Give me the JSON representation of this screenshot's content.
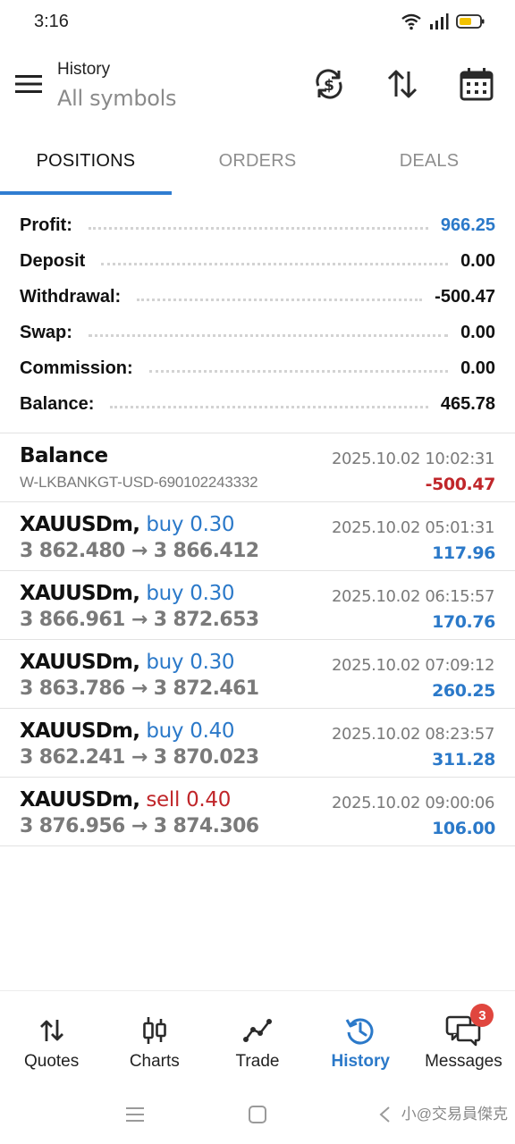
{
  "status_bar": {
    "time": "3:16"
  },
  "header": {
    "title": "History",
    "subtitle": "All symbols"
  },
  "tabs": [
    {
      "label": "POSITIONS",
      "active": true
    },
    {
      "label": "ORDERS",
      "active": false
    },
    {
      "label": "DEALS",
      "active": false
    }
  ],
  "summary": {
    "profit": {
      "label": "Profit:",
      "value": "966.25"
    },
    "deposit": {
      "label": "Deposit",
      "value": "0.00"
    },
    "withdrawal": {
      "label": "Withdrawal:",
      "value": "-500.47"
    },
    "swap": {
      "label": "Swap:",
      "value": "0.00"
    },
    "commission": {
      "label": "Commission:",
      "value": "0.00"
    },
    "balance": {
      "label": "Balance:",
      "value": "465.78"
    }
  },
  "entries": [
    {
      "title": "Balance",
      "subtitle": "W-LKBANKGT-USD-690102243332",
      "time": "2025.10.02 10:02:31",
      "amount": "-500.47"
    },
    {
      "symbol": "XAUUSDm,",
      "direction": "buy 0.30",
      "prices": "3 862.480 → 3 866.412",
      "time": "2025.10.02 05:01:31",
      "profit": "117.96"
    },
    {
      "symbol": "XAUUSDm,",
      "direction": "buy 0.30",
      "prices": "3 866.961 → 3 872.653",
      "time": "2025.10.02 06:15:57",
      "profit": "170.76"
    },
    {
      "symbol": "XAUUSDm,",
      "direction": "buy 0.30",
      "prices": "3 863.786 → 3 872.461",
      "time": "2025.10.02 07:09:12",
      "profit": "260.25"
    },
    {
      "symbol": "XAUUSDm,",
      "direction": "buy 0.40",
      "prices": "3 862.241 → 3 870.023",
      "time": "2025.10.02 08:23:57",
      "profit": "311.28"
    },
    {
      "symbol": "XAUUSDm,",
      "direction": "sell 0.40",
      "prices": "3 876.956 → 3 874.306",
      "time": "2025.10.02 09:00:06",
      "profit": "106.00"
    }
  ],
  "bottom_nav": {
    "quotes": "Quotes",
    "charts": "Charts",
    "trade": "Trade",
    "history": "History",
    "messages": "Messages",
    "messages_badge": "3"
  },
  "watermark": "小@交易員傑克",
  "colors": {
    "accent": "#2b79c9",
    "loss": "#c0262a",
    "badge": "#e0463e"
  },
  "icons": [
    "menu-icon",
    "currency-sync-icon",
    "sort-icon",
    "calendar-icon",
    "quotes-icon",
    "charts-icon",
    "trade-icon",
    "history-icon",
    "messages-icon"
  ]
}
